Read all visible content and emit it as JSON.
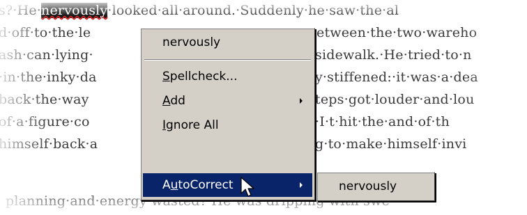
{
  "document": {
    "lines": [
      {
        "before": "s?·He·",
        "selected": "nervously",
        "after": "·looked·all·around.·Suddenly·he·saw·the·al"
      },
      {
        "before": "d·off·to·the·le",
        "selected": "",
        "after": "                    etween·the·two·wareho"
      },
      {
        "before": "ash·can·lying·",
        "selected": "",
        "after": "                     sidewalk.·He·tried·to·n"
      },
      {
        "before": "·in·the·inky·da",
        "selected": "",
        "after": "                   y·stiffened:·it·was·a·dea"
      },
      {
        "before": "back·the·way",
        "selected": "",
        "after": "                      teps·got·louder·and·lou"
      },
      {
        "before": "of·a·figure·co",
        "selected": "",
        "after": "                      ·I·t·hit·the·and·of·th"
      },
      {
        "before": "himself·back·a",
        "selected": "",
        "after": "                     g·to·make·himself·invi"
      },
      {
        "before": "planning·and·energy·wasted?·He·was·dripping·with·swe",
        "selected": "",
        "after": ""
      }
    ]
  },
  "context_menu": {
    "suggestion": "nervously",
    "spellcheck": {
      "pre": "",
      "ul": "S",
      "post": "pellcheck..."
    },
    "add": {
      "pre": "",
      "ul": "A",
      "post": "dd"
    },
    "ignore_all": {
      "pre": "",
      "ul": "I",
      "post": "gnore All"
    },
    "autocorrect": {
      "pre": "A",
      "ul": "u",
      "post": "toCorrect"
    }
  },
  "autocorrect_submenu": {
    "item": "nervously"
  },
  "colors": {
    "menu_bg": "#d4d0c8",
    "highlight": "#0a246a",
    "selection_bg": "#1a1a1a",
    "squiggle": "#d02020"
  },
  "icons": [
    "submenu-arrow-icon",
    "mouse-pointer-icon"
  ]
}
